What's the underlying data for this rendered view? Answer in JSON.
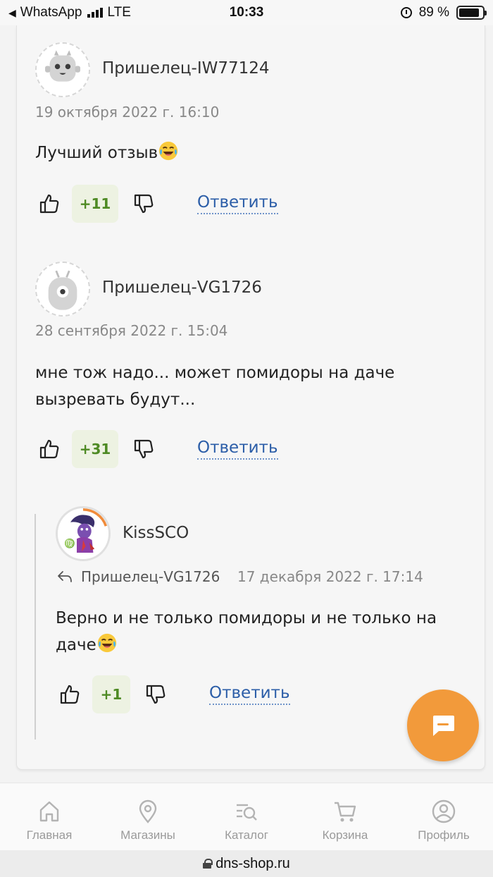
{
  "status_bar": {
    "back_app": "WhatsApp",
    "network": "LTE",
    "time": "10:33",
    "battery": "89 %",
    "battery_level": 0.89
  },
  "comments": [
    {
      "author": "Пришелец-IW77124",
      "date": "19 октября 2022 г. 16:10",
      "text": "Лучший отзыв",
      "emoji": "face-with-tears-of-joy",
      "rating": "+11",
      "reply_label": "Ответить"
    },
    {
      "author": "Пришелец-VG1726",
      "date": "28 сентября 2022 г. 15:04",
      "text_line1": "мне тож надо... может помидоры на даче",
      "text_line2": "вызревать будут...",
      "rating": "+31",
      "reply_label": "Ответить"
    },
    {
      "author": "KissSCO",
      "reply_to": "Пришелец-VG1726",
      "date": "17 декабря 2022 г. 17:14",
      "text_line1": "Верно и не только помидоры и не только на",
      "text_line2": "даче",
      "emoji": "face-with-tears-of-joy",
      "rating": "+1",
      "reply_label": "Ответить"
    }
  ],
  "chat_button": {
    "icon": "chat-bubble-icon",
    "color": "#f29a3b"
  },
  "bottom_nav": [
    {
      "label": "Главная",
      "icon": "home-icon"
    },
    {
      "label": "Магазины",
      "icon": "map-pin-icon"
    },
    {
      "label": "Каталог",
      "icon": "catalog-search-icon"
    },
    {
      "label": "Корзина",
      "icon": "cart-icon"
    },
    {
      "label": "Профиль",
      "icon": "profile-icon"
    }
  ],
  "url_bar": {
    "domain": "dns-shop.ru"
  },
  "colors": {
    "rating_text": "#4e8a24",
    "rating_bg": "#edf2e2",
    "reply_link": "#2c5ea8"
  }
}
